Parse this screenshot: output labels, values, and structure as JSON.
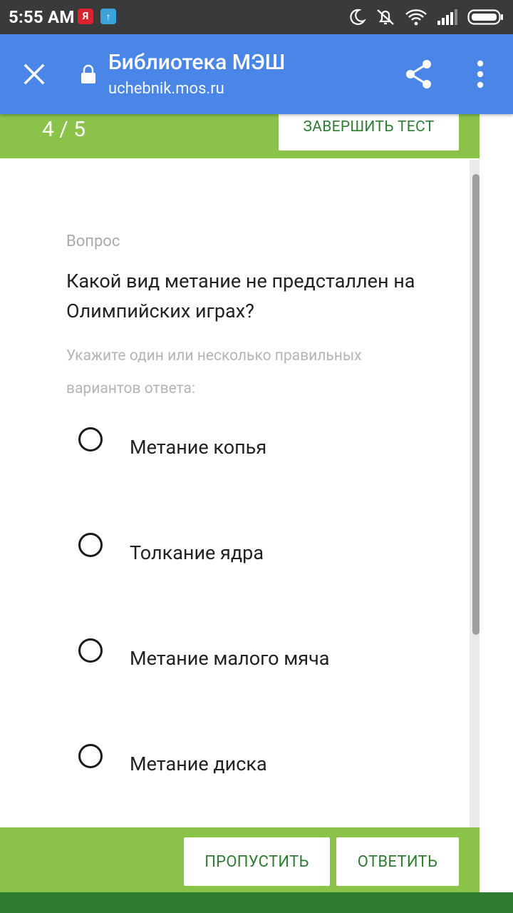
{
  "status_bar": {
    "time": "5:55 AM",
    "app_icons": [
      "yandex-icon",
      "upload-icon"
    ],
    "yandex_glyph": "Я",
    "upload_glyph": "↑",
    "indicators": [
      "moon-icon",
      "muted-bell-icon",
      "wifi-icon",
      "signal-icon",
      "battery-icon"
    ]
  },
  "appbar": {
    "title": "Библиотека МЭШ",
    "url": "uchebnik.mos.ru",
    "color": "#4a86e8"
  },
  "test": {
    "progress": "4 / 5",
    "finish_label": "ЗАВЕРШИТЬ ТЕСТ",
    "accent": "#8bc34a",
    "button_text_color": "#2e7d32"
  },
  "question": {
    "label": "Вопрос",
    "text": "Какой вид метание не предсталлен на Олимпийских играх?",
    "hint": "Укажите один или несколько правильных вариантов ответа:"
  },
  "options": [
    {
      "label": "Метание копья",
      "selected": false
    },
    {
      "label": "Толкание ядра",
      "selected": false
    },
    {
      "label": "Метание малого мяча",
      "selected": false
    },
    {
      "label": "Метание диска",
      "selected": false
    }
  ],
  "actions": {
    "skip_label": "ПРОПУСТИТЬ",
    "answer_label": "ОТВЕТИТЬ"
  }
}
